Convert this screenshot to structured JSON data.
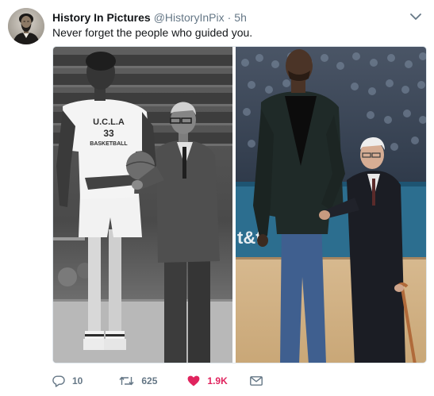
{
  "tweet": {
    "display_name": "History In Pictures",
    "handle": "@HistoryInPix",
    "separator": "·",
    "timestamp": "5h",
    "text": "Never forget the people who guided you."
  },
  "photo_text": {
    "jersey_school": "U.C.L.A",
    "jersey_number": "33",
    "jersey_word": "BASKETBALL",
    "sign": "t&t"
  },
  "actions": {
    "reply_count": "10",
    "retweet_count": "625",
    "like_count": "1.9K"
  },
  "colors": {
    "text_primary": "#14171a",
    "text_secondary": "#657786",
    "like_red": "#e0245e",
    "border": "#e1e8ed"
  },
  "icons": {
    "avatar": "lincoln-portrait",
    "caret": "chevron-down-icon",
    "reply": "reply-icon",
    "retweet": "retweet-icon",
    "like": "heart-icon",
    "message": "envelope-icon"
  }
}
